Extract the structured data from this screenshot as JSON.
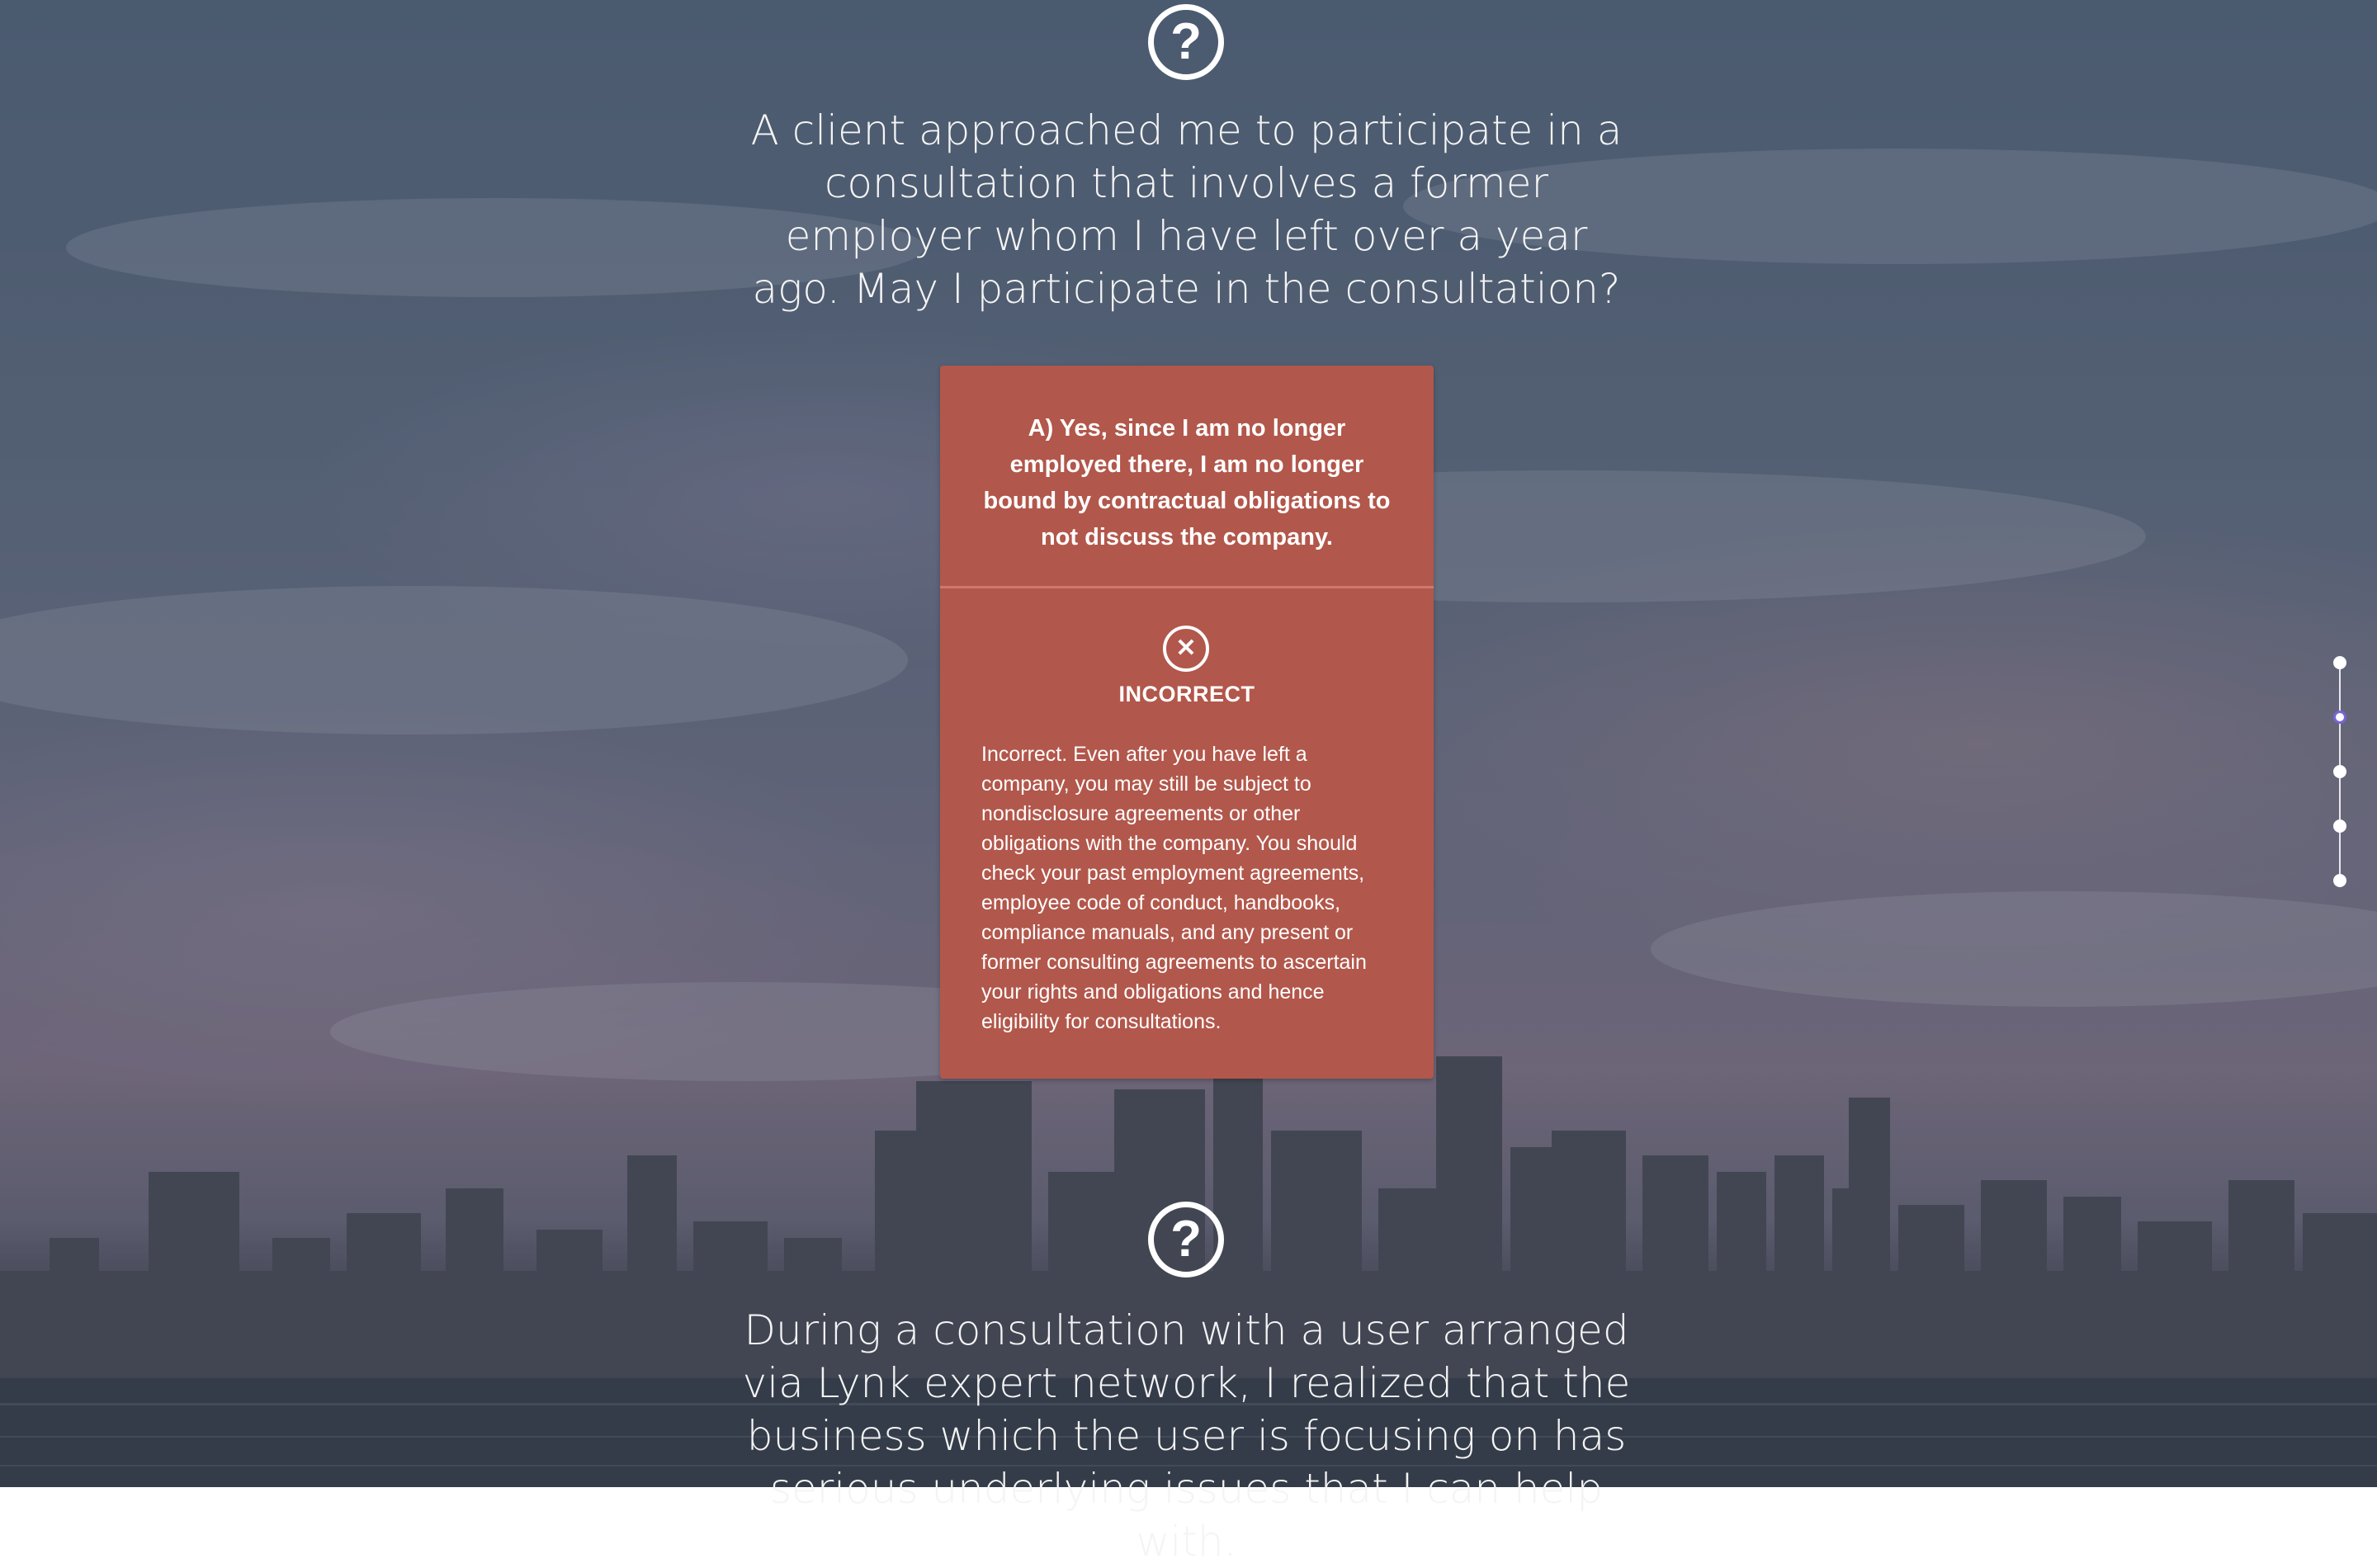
{
  "section1": {
    "question": "A client approached me to participate in a consultation that involves a former employer whom I have left over a year ago. May I participate in the consultation?",
    "icon": "question-circle-icon",
    "icon_glyph": "?"
  },
  "answer_card": {
    "answer_text": "A) Yes, since I am no longer employed there, I am no longer bound by contractual obligations to not discuss the company.",
    "result_icon": "x-circle-icon",
    "result_glyph": "✕",
    "result_label": "INCORRECT",
    "explanation": "Incorrect. Even after you have left a company, you may still be subject to nondisclosure agreements or other obligations with the company. You should check your past employment agreements, employee code of conduct, handbooks, compliance manuals, and any present or former consulting agreements to ascertain your rights and obligations and hence eligibility for consultations.",
    "background_color": "#b2574b"
  },
  "section2": {
    "question": "During a consultation with a user arranged via Lynk expert network, I realized that the business which the user is focusing on has serious underlying issues that I can help with.",
    "icon": "question-circle-icon",
    "icon_glyph": "?"
  },
  "navigation": {
    "dots": [
      {
        "id": "step-1",
        "active": false
      },
      {
        "id": "step-2",
        "active": true
      },
      {
        "id": "step-3",
        "active": false
      },
      {
        "id": "step-4",
        "active": false
      },
      {
        "id": "step-5",
        "active": false
      }
    ],
    "active_color": "#7a63d8"
  }
}
